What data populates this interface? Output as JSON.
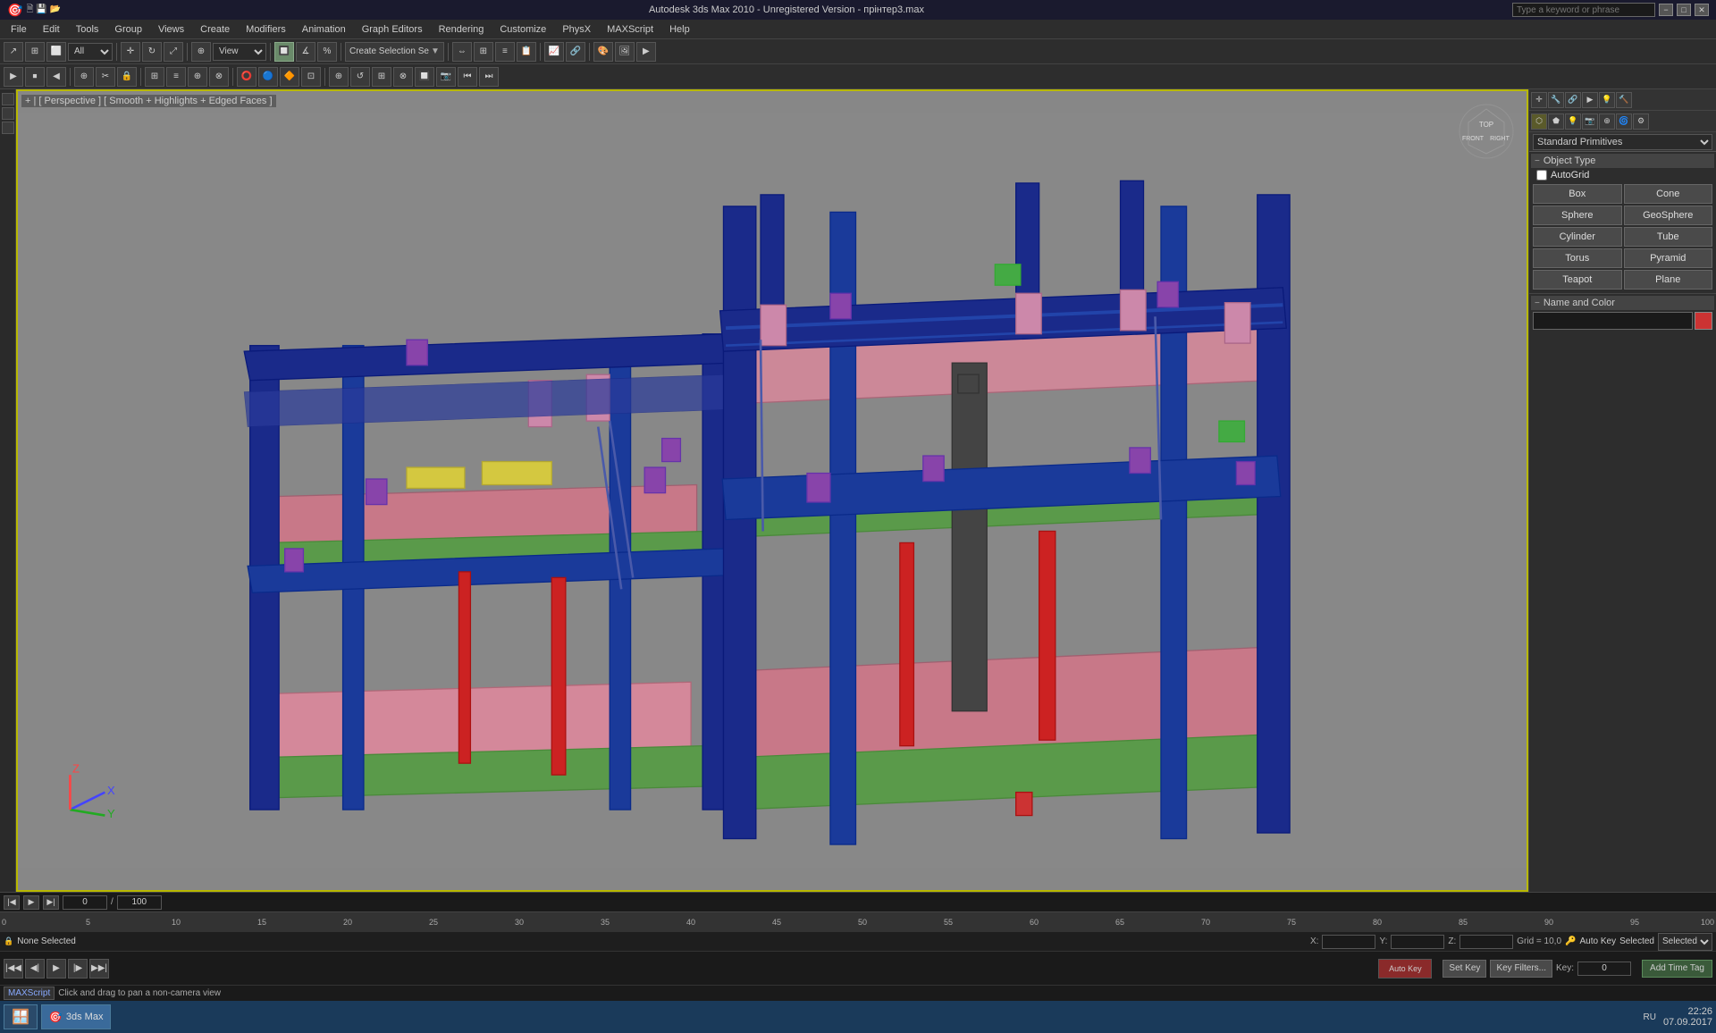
{
  "titlebar": {
    "title": "Autodesk 3ds Max 2010 - Unregistered Version - прінтер3.max",
    "search_placeholder": "Type a keyword or phrase",
    "min": "−",
    "max": "□",
    "close": "✕"
  },
  "menubar": {
    "items": [
      "File",
      "Edit",
      "Tools",
      "Group",
      "Views",
      "Create",
      "Modifiers",
      "Animation",
      "Graph Editors",
      "Rendering",
      "Customize",
      "PhysX",
      "MAXScript",
      "Help"
    ]
  },
  "toolbar1": {
    "filter_label": "All",
    "selection_mode": "Create Selection Se"
  },
  "viewport": {
    "label": "+ | [ Perspective ] [ Smooth + Highlights + Edged Faces ]",
    "smooth": "Smooth",
    "highlights": "Highlights"
  },
  "right_panel": {
    "dropdown": "Standard Primitives",
    "object_type_header": "Object Type",
    "autogrid_label": "AutoGrid",
    "buttons": [
      "Box",
      "Cone",
      "Sphere",
      "GeoSphere",
      "Cylinder",
      "Tube",
      "Torus",
      "Pyramid",
      "Teapot",
      "Plane"
    ],
    "name_color_header": "Name and Color"
  },
  "timeline": {
    "current_frame": "0",
    "total_frames": "100",
    "ticks": [
      "0",
      "5",
      "10",
      "15",
      "20",
      "25",
      "30",
      "35",
      "40",
      "45",
      "50",
      "55",
      "60",
      "65",
      "70",
      "75",
      "80",
      "85",
      "90",
      "95",
      "100"
    ]
  },
  "statusbar": {
    "selection": "None Selected",
    "x_label": "X:",
    "y_label": "Y:",
    "z_label": "Z:",
    "grid_label": "Grid = 10,0",
    "add_time_tag": "Add Time Tag",
    "set_key": "Set Key",
    "key_filters": "Key Filters...",
    "key_time": "0"
  },
  "bottombar": {
    "selected_label": "Selected",
    "auto_key": "Auto Key"
  },
  "maxscript": {
    "label": "MAXScript",
    "status": "Click and drag to pan a non-camera view"
  },
  "taskbar": {
    "start_label": ">>",
    "apps": [
      "3ds Max"
    ],
    "time": "22:26",
    "date": "07.09.2017",
    "lang": "RU"
  }
}
